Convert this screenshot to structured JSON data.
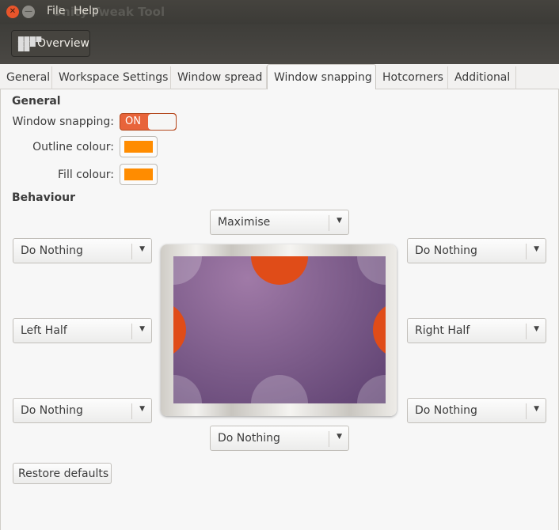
{
  "window": {
    "title": "Unity Tweak Tool",
    "menu": [
      "File",
      "Help"
    ]
  },
  "toolbar": {
    "overview_label": "Overview"
  },
  "tabs": [
    {
      "label": "General"
    },
    {
      "label": "Workspace Settings"
    },
    {
      "label": "Window spread"
    },
    {
      "label": "Window snapping",
      "active": true
    },
    {
      "label": "Hotcorners"
    },
    {
      "label": "Additional"
    }
  ],
  "general": {
    "heading": "General",
    "snapping_label": "Window snapping:",
    "snapping_state": "ON",
    "outline_label": "Outline colour:",
    "outline_color": "#ff8c00",
    "fill_label": "Fill colour:",
    "fill_color": "#ff8c00"
  },
  "behaviour": {
    "heading": "Behaviour",
    "top": "Maximise",
    "top_left": "Do Nothing",
    "top_right": "Do Nothing",
    "left": "Left Half",
    "right": "Right Half",
    "bottom_left": "Do Nothing",
    "bottom_right": "Do Nothing",
    "bottom": "Do Nothing"
  },
  "restore_label": "Restore defaults"
}
